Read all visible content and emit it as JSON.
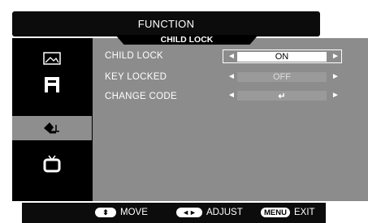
{
  "header": {
    "title": "FUNCTION"
  },
  "panel": {
    "section_title": "CHILD LOCK",
    "rows": [
      {
        "label": "CHILD LOCK",
        "value": "ON"
      },
      {
        "label": "KEY LOCKED",
        "value": "OFF"
      },
      {
        "label": "CHANGE CODE",
        "value": "↵"
      }
    ]
  },
  "sidebar": {
    "items": [
      {
        "icon": "picture-icon"
      },
      {
        "icon": "function-icon"
      },
      {
        "icon": "lock-key-icon"
      },
      {
        "icon": "tv-icon"
      }
    ],
    "selected_index": 2
  },
  "footer": {
    "move_key": "⬍",
    "move_label": "MOVE",
    "adjust_key": "◄►",
    "adjust_label": "ADJUST",
    "exit_key": "MENU",
    "exit_label": "EXIT"
  },
  "colors": {
    "panel": "#8c8c8c",
    "background": "#000000",
    "selected": "#ffffff"
  }
}
